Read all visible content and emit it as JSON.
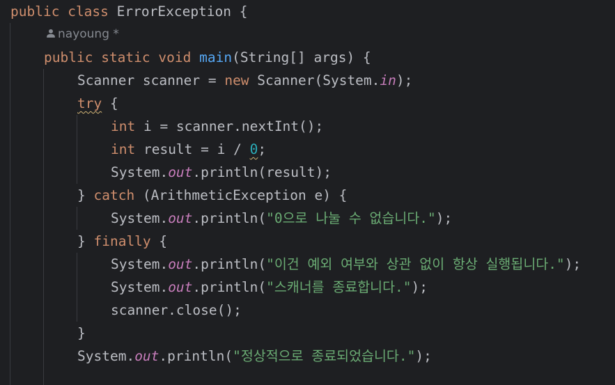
{
  "code": {
    "class_line": {
      "kw_public": "public",
      "kw_class": "class",
      "name": "ErrorException {"
    },
    "author_hint": {
      "user": "nayoung",
      "modified_mark": "*"
    },
    "main_line": {
      "kw_public": "public",
      "kw_static": "static",
      "kw_void": "void",
      "method": "main",
      "params": "(String[] args) {"
    },
    "scanner_line": {
      "decl": "Scanner scanner = ",
      "kw_new": "new",
      "ctor": " Scanner(System.",
      "field_in": "in",
      "end": ");"
    },
    "try_line": {
      "kw_try": "try",
      "brace": " {"
    },
    "int_i_line": {
      "kw_int": "int",
      "rest": " i = scanner.nextInt();"
    },
    "result_line": {
      "kw_int": "int",
      "rest": " result = i / ",
      "zero": "0",
      "semi": ";"
    },
    "print_result_line": {
      "prefix": "System.",
      "field_out": "out",
      "call": ".println(result);"
    },
    "catch_line": {
      "open": "} ",
      "kw_catch": "catch",
      "rest": " (ArithmeticException e) {"
    },
    "print_divzero_line": {
      "prefix": "System.",
      "field_out": "out",
      "call": ".println(",
      "str": "\"0으로 나눌 수 없습니다.\"",
      "end": ");"
    },
    "finally_line": {
      "open": "} ",
      "kw_finally": "finally",
      "brace": " {"
    },
    "print_always_line": {
      "prefix": "System.",
      "field_out": "out",
      "call": ".println(",
      "str": "\"이건 예외 여부와 상관 없이 항상 실행됩니다.\"",
      "end": ");"
    },
    "print_closing_line": {
      "prefix": "System.",
      "field_out": "out",
      "call": ".println(",
      "str": "\"스캐너를 종료합니다.\"",
      "end": ");"
    },
    "close_line": {
      "text": "scanner.close();"
    },
    "finally_end_line": {
      "text": "}"
    },
    "print_normal_line": {
      "prefix": "System.",
      "field_out": "out",
      "call": ".println(",
      "str": "\"정상적으로 종료되었습니다.\"",
      "end": ");"
    }
  },
  "colors": {
    "background": "#1e1f22",
    "text": "#bcbec4",
    "keyword": "#cf8e6d",
    "method_decl": "#56a8f5",
    "string": "#6aab73",
    "number": "#2aacb8",
    "static_field": "#c77dbb",
    "inlay_hint": "#868a91",
    "indent_guide": "#393b40",
    "warning_squiggle": "#d5b778"
  },
  "icons": {
    "author": "person-icon"
  }
}
